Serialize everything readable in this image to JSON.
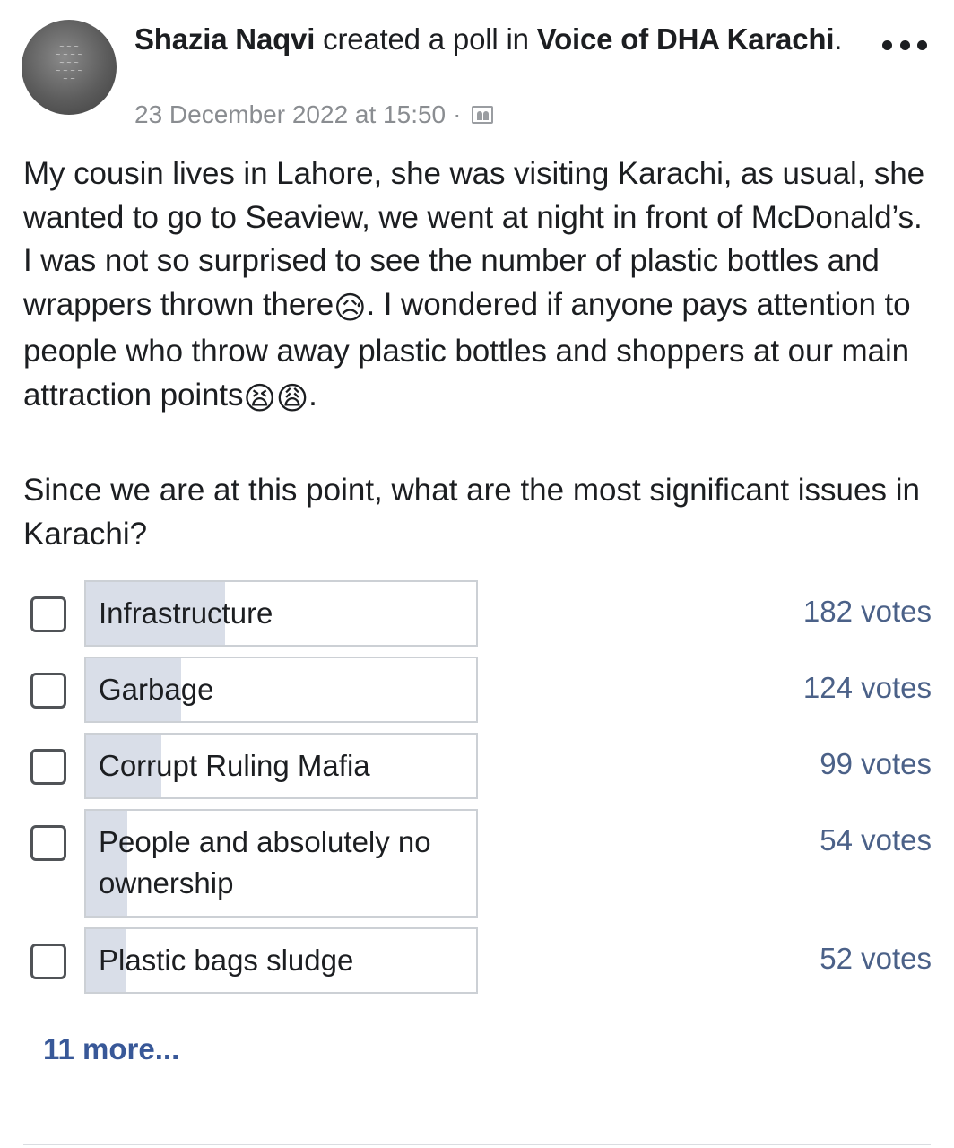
{
  "post": {
    "author": "Shazia Naqvi",
    "action_text": " created a poll in ",
    "group": "Voice of DHA Karachi",
    "end_punct": ".",
    "timestamp": "23 December 2022 at 15:50",
    "separator": "·",
    "privacy_icon": "group-members-icon",
    "avatar_icon": "profile-photo"
  },
  "body": {
    "paragraph1_a": "My cousin lives in Lahore, she was visiting Karachi, as usual, she wanted to go to Seaview, we went at night in front of McDonald’s. I was not so surprised to see the number of plastic bottles and wrappers thrown there",
    "emoji_sad": "😥",
    "paragraph1_b": ". I wondered if anyone pays attention to people who throw away plastic bottles and shoppers at our main attraction points",
    "emoji_tired1": "😫",
    "emoji_tired2": "😩",
    "paragraph1_c": ".",
    "question": "Since we are at this point, what are the most significant issues in Karachi?"
  },
  "poll": {
    "options": [
      {
        "label": "Infrastructure",
        "votes": "182 votes",
        "count": 182
      },
      {
        "label": "Garbage",
        "votes": "124 votes",
        "count": 124
      },
      {
        "label": "Corrupt Ruling Mafia",
        "votes": "99 votes",
        "count": 99
      },
      {
        "label": "People and absolutely no ownership",
        "votes": "54 votes",
        "count": 54
      },
      {
        "label": "Plastic bags sludge",
        "votes": "52 votes",
        "count": 52
      }
    ],
    "more_label": "11 more..."
  },
  "colors": {
    "fill": "#d9dee8",
    "votes": "#4b6188",
    "link": "#385898",
    "meta": "#8a8d91"
  }
}
